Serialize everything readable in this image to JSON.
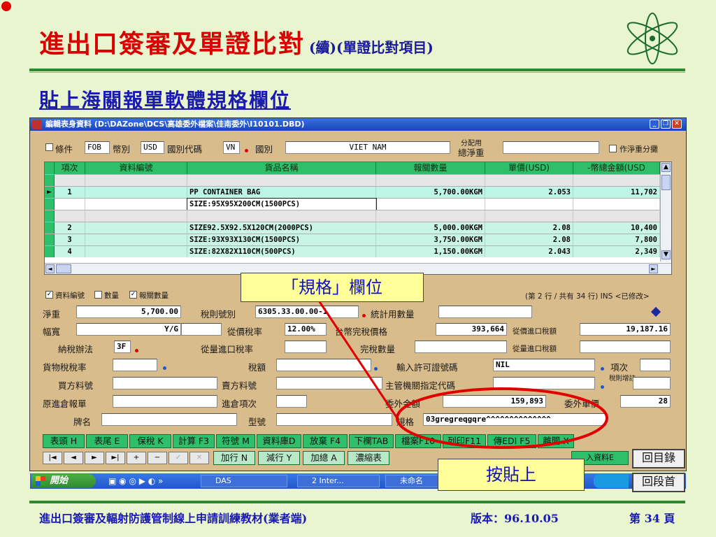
{
  "slide": {
    "title": "進出口簽審及單證比對",
    "title_sub": "(續)(單證比對項目)",
    "heading": "貼上海關報單軟體規格欄位",
    "footer_left": "進出口簽審及輻射防護管制線上申請訓練教材(業者端)",
    "footer_version": "版本：96.10.05",
    "footer_page": "第 34 頁",
    "callout_spec": "「規格」欄位",
    "callout_paste": "按貼上",
    "nav_toc": "回目錄",
    "nav_section": "回段首"
  },
  "window": {
    "title": "編輯表身資料 (D:\\DAZone\\DCS\\高雄委外檔案\\佳南委外\\I10101.DBD)"
  },
  "header_fields": {
    "terms_label": "條件",
    "terms_value": "FOB",
    "currency_label": "幣別",
    "currency_value": "USD",
    "country_code_label": "國別代碼",
    "country_code_value": "VN",
    "country_label": "國別",
    "country_value": "VIET NAM",
    "alloc_label_top": "分配用",
    "alloc_label_bottom": "總淨重",
    "net_alloc_label": "作淨重分攤"
  },
  "grid": {
    "columns": [
      "項次",
      "資料編號",
      "貨品名稱",
      "報關數量",
      "單價(USD)",
      "-幣總金額(USD"
    ],
    "rows": [
      {
        "item": "",
        "code": "",
        "name": "",
        "qty": "",
        "price": "",
        "amount": "",
        "style": "blank"
      },
      {
        "item": "1",
        "code": "",
        "name": "PP CONTAINER BAG",
        "qty": "5,700.00KGM",
        "price": "2.053",
        "amount": "11,702",
        "style": "current"
      },
      {
        "item": "",
        "code": "",
        "name": "SIZE:95X95X200CM(1500PCS)",
        "qty": "",
        "price": "",
        "amount": "",
        "style": "sel"
      },
      {
        "item": "",
        "code": "",
        "name": "",
        "qty": "",
        "price": "",
        "amount": "",
        "style": "blank"
      },
      {
        "item": "2",
        "code": "",
        "name": "SIZE92.5X92.5X120CM(2000PCS)",
        "qty": "5,000.00KGM",
        "price": "2.08",
        "amount": "10,400",
        "style": "alt"
      },
      {
        "item": "3",
        "code": "",
        "name": "SIZE:93X93X130CM(1500PCS)",
        "qty": "3,750.00KGM",
        "price": "2.08",
        "amount": "7,800",
        "style": "alt"
      },
      {
        "item": "4",
        "code": "",
        "name": "SIZE:82X82X110CM(500PCS)",
        "qty": "1,150.00KGM",
        "price": "2.043",
        "amount": "2,349",
        "style": "alt"
      }
    ],
    "opt_code": "資料編號",
    "opt_qty": "數量",
    "opt_qty_unit": "報關數量",
    "status": "(第 2 行 / 共有 34 行) INS <已修改>"
  },
  "detail": {
    "net_weight_label": "淨重",
    "net_weight_value": "5,700.00",
    "tariff_label": "稅則號別",
    "tariff_value": "6305.33.00.00-1",
    "stat_qty_label": "統計用數量",
    "width_label": "幅寬",
    "width_unit": "Y/G",
    "ad_rate_label": "從價稅率",
    "ad_rate_value": "12.00%",
    "duty_value_label": "台幣完稅價格",
    "duty_value_value": "393,664",
    "ad_import_label": "從價進口稅額",
    "ad_import_value": "19,187.16",
    "tax_method_label": "納稅辦法",
    "tax_method_value": "3F",
    "spec_rate_label": "從量進口稅率",
    "duty_qty_label": "完稅數量",
    "spec_import_label": "從量進口稅額",
    "goods_tax_label": "貨物稅稅率",
    "tax_amt_label": "稅額",
    "permit_label": "輸入許可證號碼",
    "permit_value": "NIL",
    "item_no_label": "項次",
    "buyer_code_label": "買方料號",
    "seller_code_label": "賣方料號",
    "agency_label": "主管機關指定代碼",
    "tariff_note_label": "稅則增註",
    "orig_entry_label": "原進倉報單",
    "entry_item_label": "進倉項次",
    "outsource_amt_label": "委外金額",
    "outsource_amt_value": "159,893",
    "outsource_price_label": "委外單價",
    "outsource_price_value": "28",
    "brand_label": "牌名",
    "model_label": "型號",
    "spec_label": "規格",
    "spec_value": "03gregreqgqre^^^^^^^^^^^^^^"
  },
  "buttons_row1": [
    "表頭 H",
    "表尾 E",
    "保稅 K",
    "計算 F3",
    "符號 M",
    "資料庫D",
    "放棄 F4",
    "下欄TAB",
    "檔案F10",
    "列印F11",
    "傳EDI F5",
    "離開 X"
  ],
  "buttons_row2": [
    "加行 N",
    "減行 Y",
    "加總 A",
    "濃縮表"
  ],
  "buttons_row2_right": "入資料E",
  "nav_glyphs": [
    "|◄",
    "◄",
    "►",
    "►|",
    "+",
    "−",
    "✓",
    "✕"
  ],
  "taskbar": {
    "start": "開始",
    "items": [
      "DAS",
      "2 Inter...",
      "未命名"
    ]
  }
}
